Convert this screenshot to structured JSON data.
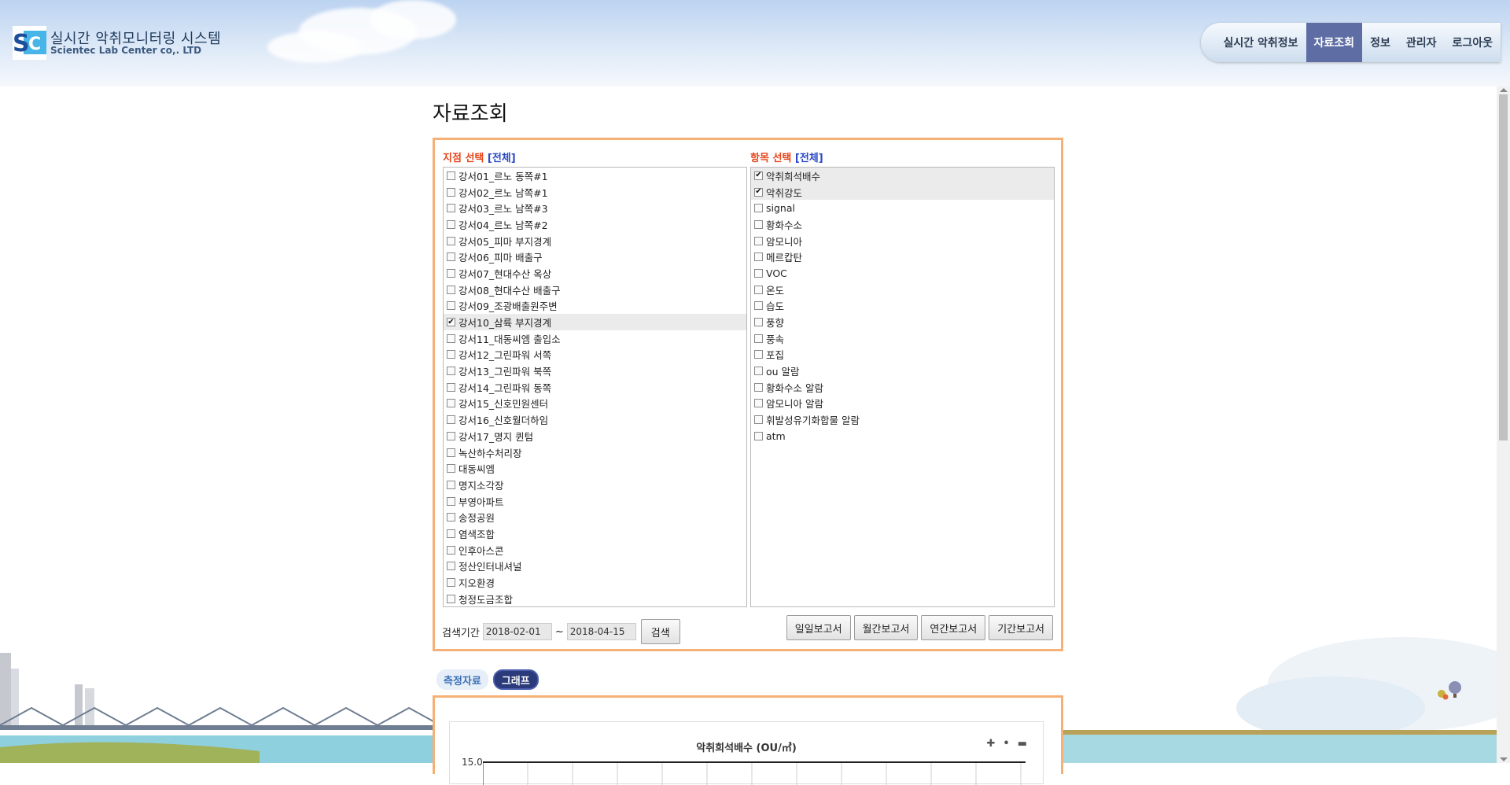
{
  "app": {
    "title": "실시간 악취모니터링 시스템",
    "subtitle": "Scientec Lab Center co,. LTD"
  },
  "nav": {
    "items": [
      "실시간 악취정보",
      "자료조회",
      "정보",
      "관리자",
      "로그아웃"
    ],
    "active_index": 1
  },
  "page": {
    "title": "자료조회"
  },
  "site_selection": {
    "label": "지점 선택",
    "all_label": "[전체]",
    "items": [
      {
        "label": "강서01_르노 동쪽#1",
        "checked": false
      },
      {
        "label": "강서02_르노 남쪽#1",
        "checked": false
      },
      {
        "label": "강서03_르노 남쪽#3",
        "checked": false
      },
      {
        "label": "강서04_르노 남쪽#2",
        "checked": false
      },
      {
        "label": "강서05_피마 부지경계",
        "checked": false
      },
      {
        "label": "강서06_피마 배출구",
        "checked": false
      },
      {
        "label": "강서07_현대수산 옥상",
        "checked": false
      },
      {
        "label": "강서08_현대수산 배출구",
        "checked": false
      },
      {
        "label": "강서09_조광배출원주변",
        "checked": false
      },
      {
        "label": "강서10_삼륙 부지경계",
        "checked": true
      },
      {
        "label": "강서11_대동씨엠 출입소",
        "checked": false
      },
      {
        "label": "강서12_그린파워 서쪽",
        "checked": false
      },
      {
        "label": "강서13_그린파워 북쪽",
        "checked": false
      },
      {
        "label": "강서14_그린파워 동쪽",
        "checked": false
      },
      {
        "label": "강서15_신호민원센터",
        "checked": false
      },
      {
        "label": "강서16_신호월더하임",
        "checked": false
      },
      {
        "label": "강서17_명지 퀸텀",
        "checked": false
      },
      {
        "label": "녹산하수처리장",
        "checked": false
      },
      {
        "label": "대동씨엠",
        "checked": false
      },
      {
        "label": "명지소각장",
        "checked": false
      },
      {
        "label": "부영아파트",
        "checked": false
      },
      {
        "label": "송정공원",
        "checked": false
      },
      {
        "label": "염색조합",
        "checked": false
      },
      {
        "label": "인후아스콘",
        "checked": false
      },
      {
        "label": "정산인터내셔널",
        "checked": false
      },
      {
        "label": "지오환경",
        "checked": false
      },
      {
        "label": "청정도금조합",
        "checked": false
      }
    ]
  },
  "item_selection": {
    "label": "항목 선택",
    "all_label": "[전체]",
    "items": [
      {
        "label": "악취희석배수",
        "checked": true
      },
      {
        "label": "악취강도",
        "checked": true
      },
      {
        "label": "signal",
        "checked": false
      },
      {
        "label": "황화수소",
        "checked": false
      },
      {
        "label": "암모니아",
        "checked": false
      },
      {
        "label": "메르캅탄",
        "checked": false
      },
      {
        "label": "VOC",
        "checked": false
      },
      {
        "label": "온도",
        "checked": false
      },
      {
        "label": "습도",
        "checked": false
      },
      {
        "label": "풍향",
        "checked": false
      },
      {
        "label": "풍속",
        "checked": false
      },
      {
        "label": "포집",
        "checked": false
      },
      {
        "label": "ou 알람",
        "checked": false
      },
      {
        "label": "황화수소 알람",
        "checked": false
      },
      {
        "label": "암모니아 알람",
        "checked": false
      },
      {
        "label": "휘발성유기화합물 알람",
        "checked": false
      },
      {
        "label": "atm",
        "checked": false
      }
    ]
  },
  "search": {
    "period_label": "검색기간",
    "start_date": "2018-02-01",
    "tilde": "~",
    "end_date": "2018-04-15",
    "search_button": "검색"
  },
  "reports": {
    "daily": "일일보고서",
    "monthly": "월간보고서",
    "yearly": "연간보고서",
    "period": "기간보고서"
  },
  "result_tabs": {
    "measurement": "측정자료",
    "graph": "그래프"
  },
  "chart": {
    "title": "악취희석배수 (OU/㎥)",
    "zoom_in": "✚",
    "reset": "•",
    "zoom_out": "▬",
    "y_top_tick": "15.0"
  },
  "colors": {
    "accent_orange": "#f5b076",
    "label_red": "#e7451c",
    "link_blue": "#2947c6",
    "nav_active": "#5e6ea5"
  }
}
